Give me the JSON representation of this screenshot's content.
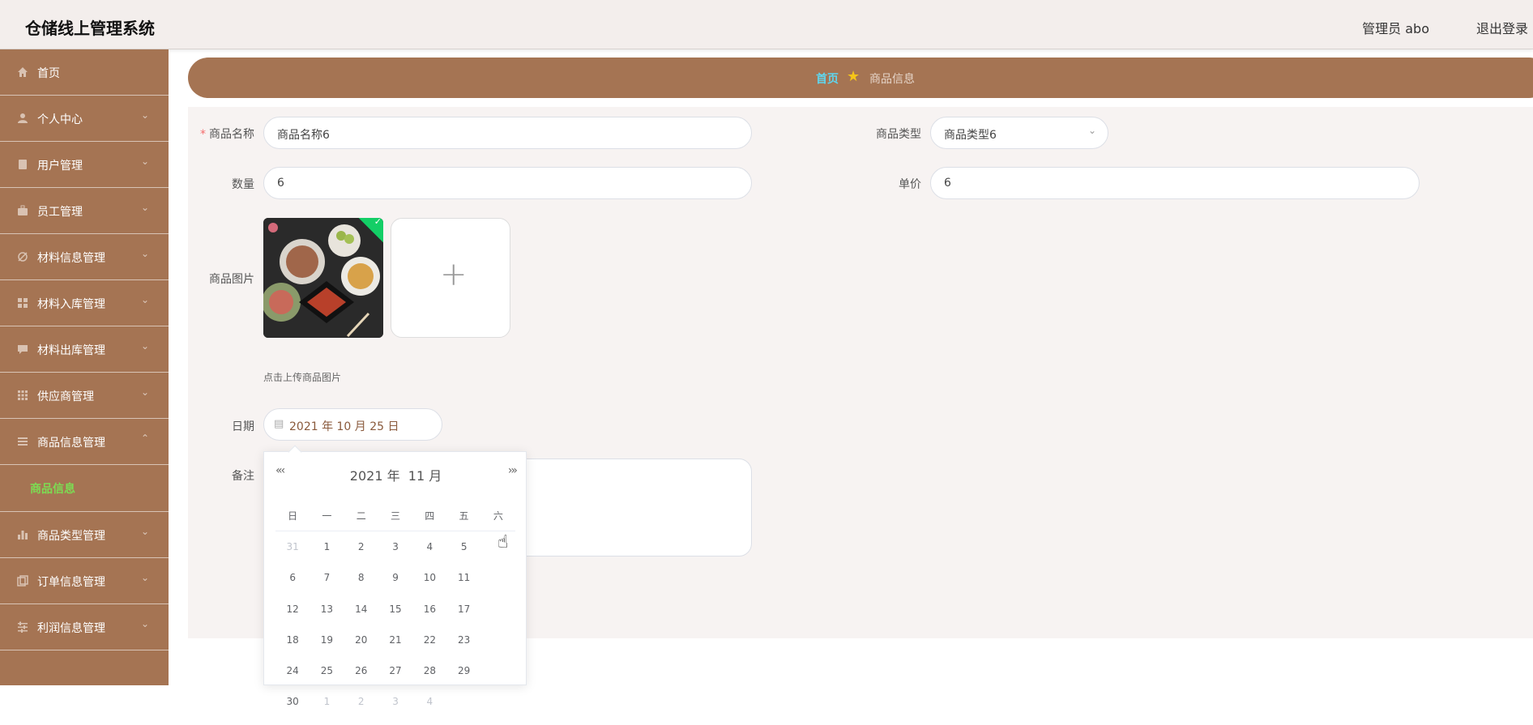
{
  "app": {
    "title": "仓储线上管理系统",
    "user_label": "管理员 abo",
    "logout_label": "退出登录"
  },
  "sidebar": {
    "items": [
      {
        "label": "首页",
        "icon": "home-icon",
        "chevron": ""
      },
      {
        "label": "个人中心",
        "icon": "user-icon",
        "chevron": "⌄"
      },
      {
        "label": "用户管理",
        "icon": "book-icon",
        "chevron": "⌄"
      },
      {
        "label": "员工管理",
        "icon": "briefcase-icon",
        "chevron": "⌄"
      },
      {
        "label": "材料信息管理",
        "icon": "crossed-circle-icon",
        "chevron": "⌄"
      },
      {
        "label": "材料入库管理",
        "icon": "grid-icon",
        "chevron": "⌄"
      },
      {
        "label": "材料出库管理",
        "icon": "chat-icon",
        "chevron": "⌄"
      },
      {
        "label": "供应商管理",
        "icon": "apps-icon",
        "chevron": "⌄"
      },
      {
        "label": "商品信息管理",
        "icon": "list-icon",
        "chevron": "⌃"
      }
    ],
    "sub_item": "商品信息",
    "items_after": [
      {
        "label": "商品类型管理",
        "icon": "bar-chart-icon",
        "chevron": "⌄"
      },
      {
        "label": "订单信息管理",
        "icon": "copy-icon",
        "chevron": "⌄"
      },
      {
        "label": "利润信息管理",
        "icon": "sliders-icon",
        "chevron": "⌄"
      }
    ]
  },
  "breadcrumb": {
    "home": "首页",
    "star": "★",
    "current": "商品信息"
  },
  "form": {
    "name_label": "商品名称",
    "name_required": "*",
    "name_value": "商品名称6",
    "type_label": "商品类型",
    "type_value": "商品类型6",
    "type_arrow": "⌄",
    "qty_label": "数量",
    "qty_value": "6",
    "price_label": "单价",
    "price_value": "6",
    "image_label": "商品图片",
    "upload_plus": "+",
    "upload_hint": "点击上传商品图片",
    "image_check": "✓",
    "date_label": "日期",
    "date_value": "2021 年 10 月 25 日",
    "date_icon": "▤",
    "note_label": "备注"
  },
  "datepicker": {
    "prev": "«‹",
    "next": "›»",
    "year": "2021 年",
    "month": "11 月",
    "weekdays": [
      "日",
      "一",
      "二",
      "三",
      "四",
      "五",
      "六"
    ],
    "days": [
      [
        "31",
        "1",
        "2",
        "3",
        "4",
        "5",
        "6"
      ],
      [
        "7",
        "8",
        "9",
        "10",
        "11",
        "12",
        "13"
      ],
      [
        "14",
        "15",
        "16",
        "17",
        "18",
        "19",
        "20"
      ],
      [
        "21",
        "22",
        "23",
        "24",
        "25",
        "26",
        "27"
      ],
      [
        "28",
        "29",
        "30",
        "1",
        "2",
        "3",
        "4"
      ]
    ],
    "dim": [
      [
        true,
        false,
        false,
        false,
        false,
        false,
        false
      ],
      [
        false,
        false,
        false,
        false,
        false,
        false,
        false
      ],
      [
        false,
        false,
        false,
        false,
        false,
        false,
        false
      ],
      [
        false,
        false,
        false,
        false,
        false,
        false,
        false
      ],
      [
        false,
        false,
        false,
        true,
        true,
        true,
        true
      ]
    ]
  },
  "colors": {
    "sidebar": "#a57453",
    "accent_green": "#7cdc53",
    "breadcrumb_home": "#5fd6ee"
  }
}
